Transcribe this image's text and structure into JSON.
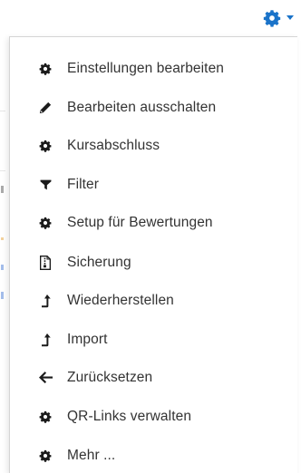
{
  "colors": {
    "accent": "#1a73c9",
    "text": "#333333",
    "icon": "#1b1b1b"
  },
  "trigger": {
    "icon": "gear-icon",
    "caret_icon": "caret-down-icon"
  },
  "menu": {
    "items": [
      {
        "label": "Einstellungen bearbeiten",
        "icon": "gear-icon"
      },
      {
        "label": "Bearbeiten ausschalten",
        "icon": "pencil-icon"
      },
      {
        "label": "Kursabschluss",
        "icon": "gear-icon"
      },
      {
        "label": "Filter",
        "icon": "filter-icon"
      },
      {
        "label": "Setup für Bewertungen",
        "icon": "gear-icon"
      },
      {
        "label": "Sicherung",
        "icon": "file-archive-icon"
      },
      {
        "label": "Wiederherstellen",
        "icon": "level-up-icon"
      },
      {
        "label": "Import",
        "icon": "level-up-icon"
      },
      {
        "label": "Zurücksetzen",
        "icon": "arrow-left-icon"
      },
      {
        "label": "QR-Links verwalten",
        "icon": "gear-icon"
      },
      {
        "label": "Mehr ...",
        "icon": "gear-icon"
      }
    ]
  }
}
